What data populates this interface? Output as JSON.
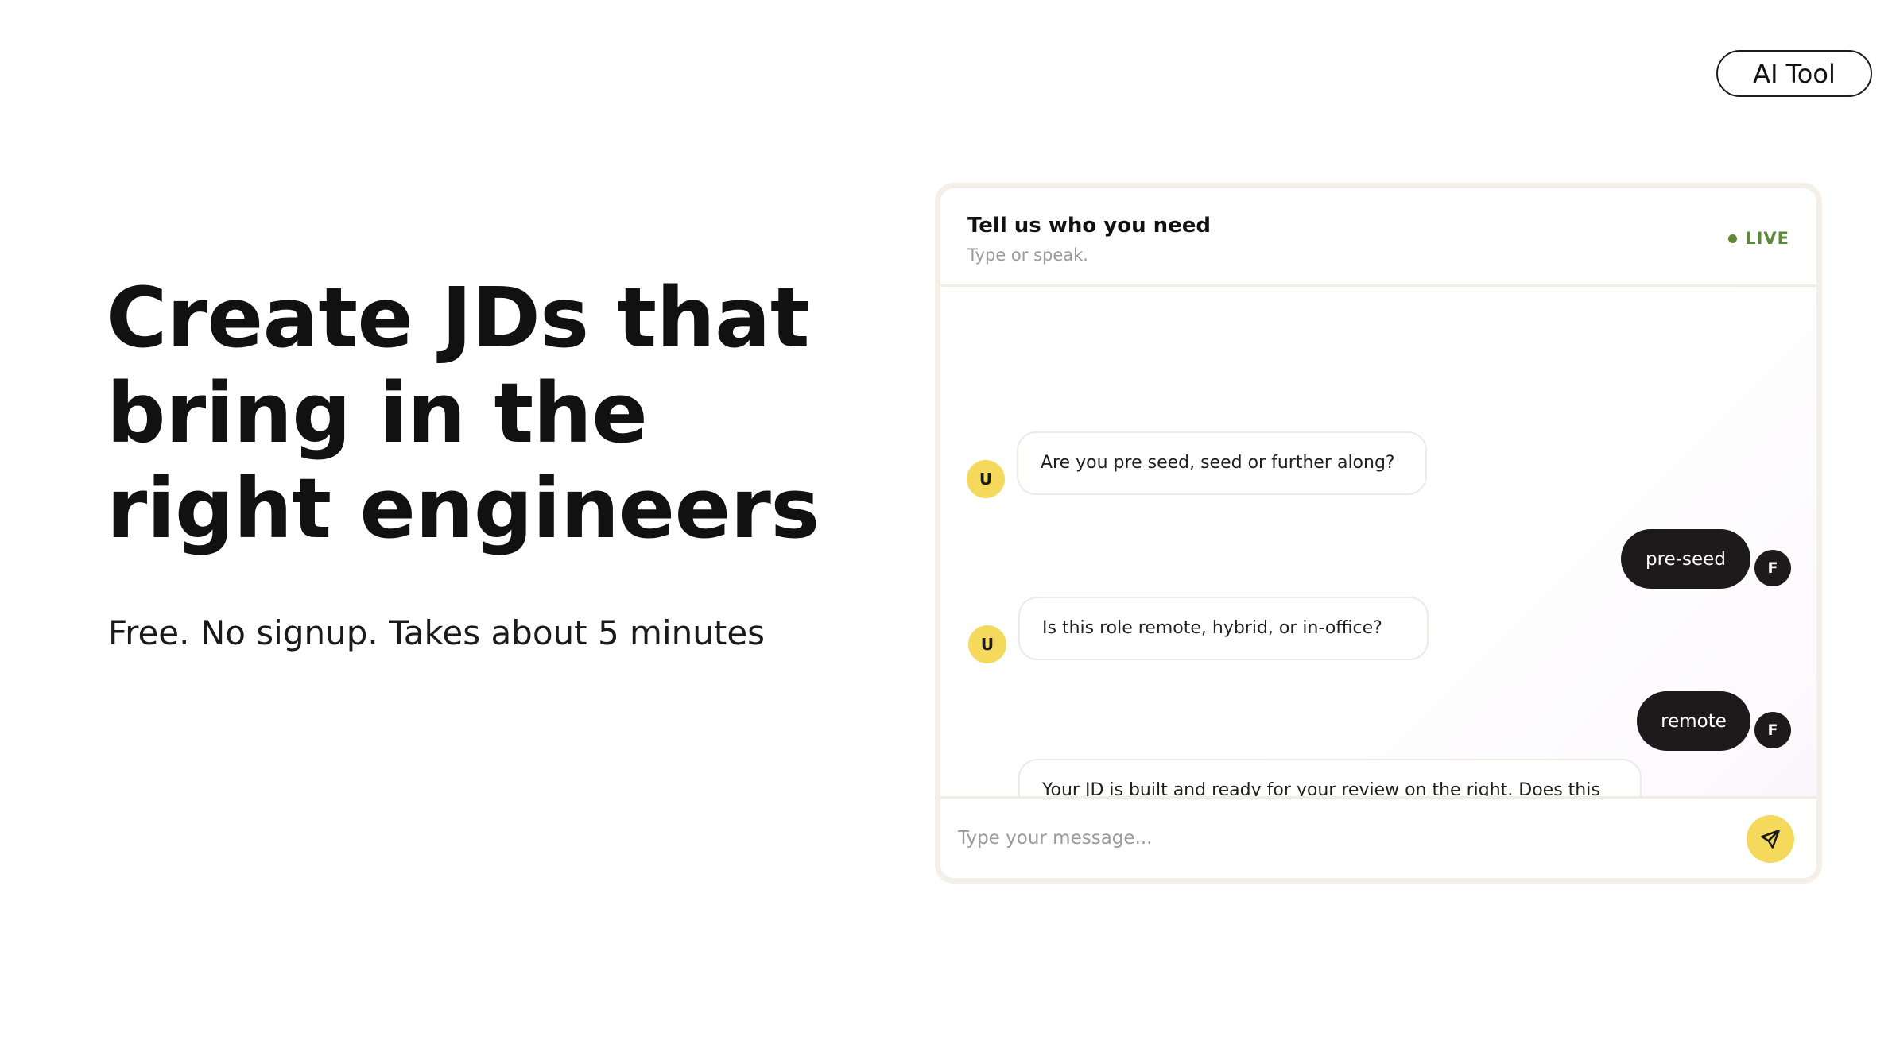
{
  "tag": {
    "label": "AI Tool"
  },
  "hero": {
    "title": "Create JDs that bring in the right engineers",
    "subtitle": "Free. No signup. Takes about 5 minutes"
  },
  "chat": {
    "title": "Tell us who you need",
    "subtitle": "Type or speak.",
    "status": "LIVE",
    "status_color": "#5d8a3a",
    "messages": [
      {
        "sender": "bot",
        "avatar": "U",
        "text": "Are you pre seed, seed or further along?"
      },
      {
        "sender": "user",
        "avatar": "F",
        "text": "pre-seed"
      },
      {
        "sender": "bot",
        "avatar": "U",
        "text": "Is this role remote, hybrid, or in-office?"
      },
      {
        "sender": "user",
        "avatar": "F",
        "text": "remote"
      },
      {
        "sender": "bot",
        "avatar": "U",
        "text": "Your JD is built and ready for your review on the right. Does this look good to you, or anything you want to change?"
      }
    ],
    "composer": {
      "placeholder": "Type your message...",
      "send_icon": "send-icon"
    }
  },
  "colors": {
    "accent_yellow": "#f4d95c",
    "user_bubble": "#1c1a1b",
    "card_border": "#f4efe7"
  }
}
